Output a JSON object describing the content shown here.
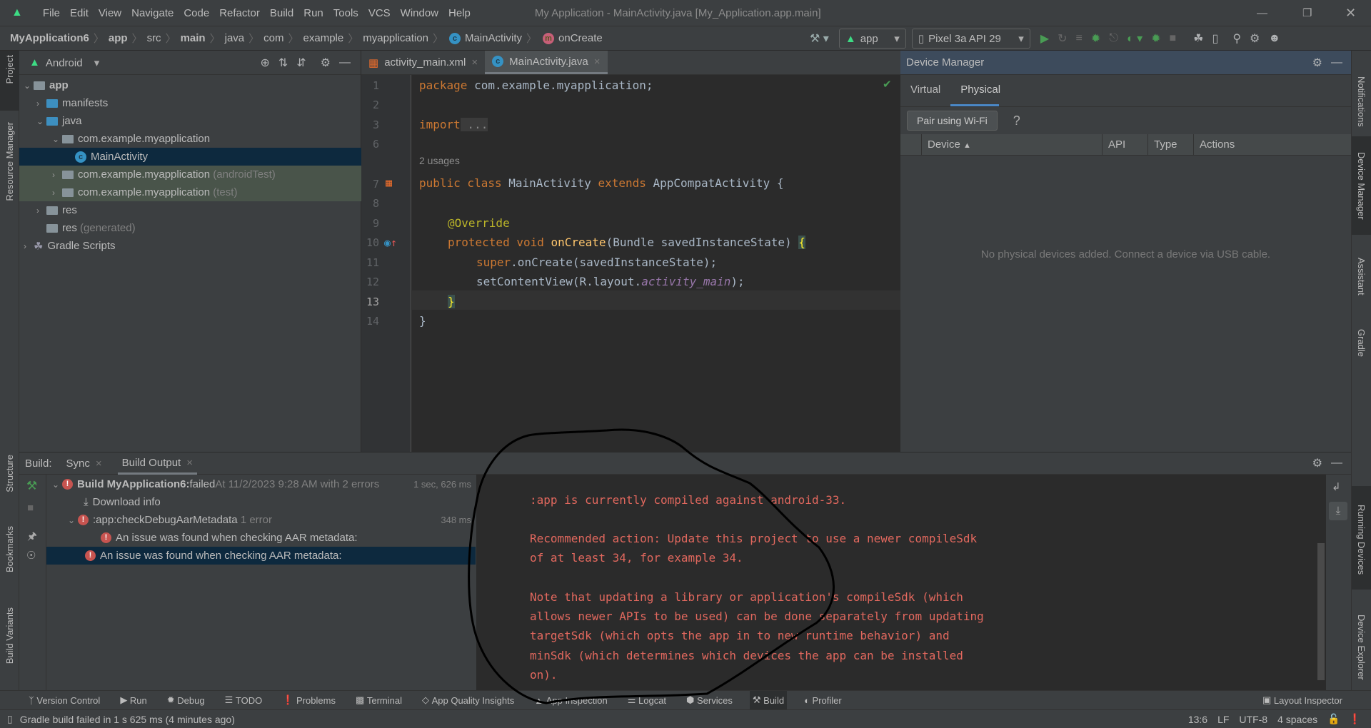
{
  "menu": {
    "items": [
      "File",
      "Edit",
      "View",
      "Navigate",
      "Code",
      "Refactor",
      "Build",
      "Run",
      "Tools",
      "VCS",
      "Window",
      "Help"
    ],
    "window_title": "My Application - MainActivity.java [My_Application.app.main]"
  },
  "nav": {
    "crumbs": [
      "MyApplication6",
      "app",
      "src",
      "main",
      "java",
      "com",
      "example",
      "myapplication",
      "MainActivity",
      "onCreate"
    ],
    "run_config": "app",
    "device": "Pixel 3a API 29"
  },
  "left_stripe": {
    "project": "Project",
    "resource_manager": "Resource Manager",
    "structure": "Structure",
    "bookmarks": "Bookmarks",
    "build_variants": "Build Variants"
  },
  "right_stripe": {
    "notifications": "Notifications",
    "device_manager": "Device Manager",
    "assistant": "Assistant",
    "gradle": "Gradle",
    "running_devices": "Running Devices",
    "device_explorer": "Device Explorer"
  },
  "project": {
    "view": "Android",
    "tree": [
      {
        "label": "app",
        "suffix": ""
      },
      {
        "label": "manifests",
        "suffix": ""
      },
      {
        "label": "java",
        "suffix": ""
      },
      {
        "label": "com.example.myapplication",
        "suffix": ""
      },
      {
        "label": "MainActivity",
        "suffix": ""
      },
      {
        "label": "com.example.myapplication",
        "suffix": "(androidTest)"
      },
      {
        "label": "com.example.myapplication",
        "suffix": "(test)"
      },
      {
        "label": "res",
        "suffix": ""
      },
      {
        "label": "res",
        "suffix": "(generated)"
      },
      {
        "label": "Gradle Scripts",
        "suffix": ""
      }
    ]
  },
  "editor": {
    "tabs": [
      "activity_main.xml",
      "MainActivity.java"
    ],
    "active_tab": "MainActivity.java",
    "line_numbers": [
      "1",
      "2",
      "3",
      "6",
      "7",
      "8",
      "9",
      "10",
      "11",
      "12",
      "13",
      "14"
    ],
    "usages_hint": "2 usages",
    "code": {
      "l1a": "package",
      "l1b": " com.example.myapplication;",
      "l3a": "import",
      "l3b": " ...",
      "l7a": "public class",
      "l7b": " MainActivity ",
      "l7c": "extends",
      "l7d": " AppCompatActivity {",
      "l9": "@Override",
      "l10a": "protected void",
      "l10b": "onCreate",
      "l10c": "(Bundle savedInstanceState) ",
      "l10d": "{",
      "l11a": "super",
      "l11b": ".onCreate(savedInstanceState);",
      "l12a": "setContentView(R.layout.",
      "l12b": "activity_main",
      "l12c": ");",
      "l13": "}",
      "l14": "}"
    }
  },
  "device_manager": {
    "title": "Device Manager",
    "tabs": [
      "Virtual",
      "Physical"
    ],
    "active_tab": "Physical",
    "pair_button": "Pair using Wi-Fi",
    "help": "?",
    "columns": [
      "Device",
      "API",
      "Type",
      "Actions"
    ],
    "empty_message": "No physical devices added. Connect a device via USB cable."
  },
  "build": {
    "label": "Build:",
    "tabs": [
      "Sync",
      "Build Output"
    ],
    "active_tab": "Build Output",
    "tree": [
      {
        "bold": "Build MyApplication6:",
        "text": " failed",
        "meta": " At 11/2/2023 9:28 AM with 2 errors",
        "time": "1 sec, 626 ms"
      },
      {
        "text": "Download info"
      },
      {
        "text": ":app:checkDebugAarMetadata",
        "meta": "1 error",
        "time": "348 ms"
      },
      {
        "text": "An issue was found when checking AAR metadata:"
      },
      {
        "text": "An issue was found when checking AAR metadata:"
      }
    ],
    "output": [
      ":app is currently compiled against android-33.",
      "Recommended action: Update this project to use a newer compileSdk",
      "of at least 34, for example 34.",
      "Note that updating a library or application's compileSdk (which",
      "allows newer APIs to be used) can be done separately from updating",
      "targetSdk (which opts the app in to new runtime behavior) and",
      "minSdk (which determines which devices the app can be installed",
      "on)."
    ]
  },
  "toolwindows": [
    "Version Control",
    "Run",
    "Debug",
    "TODO",
    "Problems",
    "Terminal",
    "App Quality Insights",
    "App Inspection",
    "Logcat",
    "Services",
    "Build",
    "Profiler"
  ],
  "layout_inspector": "Layout Inspector",
  "status": {
    "message": "Gradle build failed in 1 s 625 ms (4 minutes ago)",
    "position": "13:6",
    "line_sep": "LF",
    "encoding": "UTF-8",
    "indent": "4 spaces"
  },
  "colors": {
    "accent": "#4a88c7",
    "error": "#c75450",
    "output_text": "#e2685e",
    "selection": "#0d293e",
    "android_green": "#3ddc84"
  }
}
